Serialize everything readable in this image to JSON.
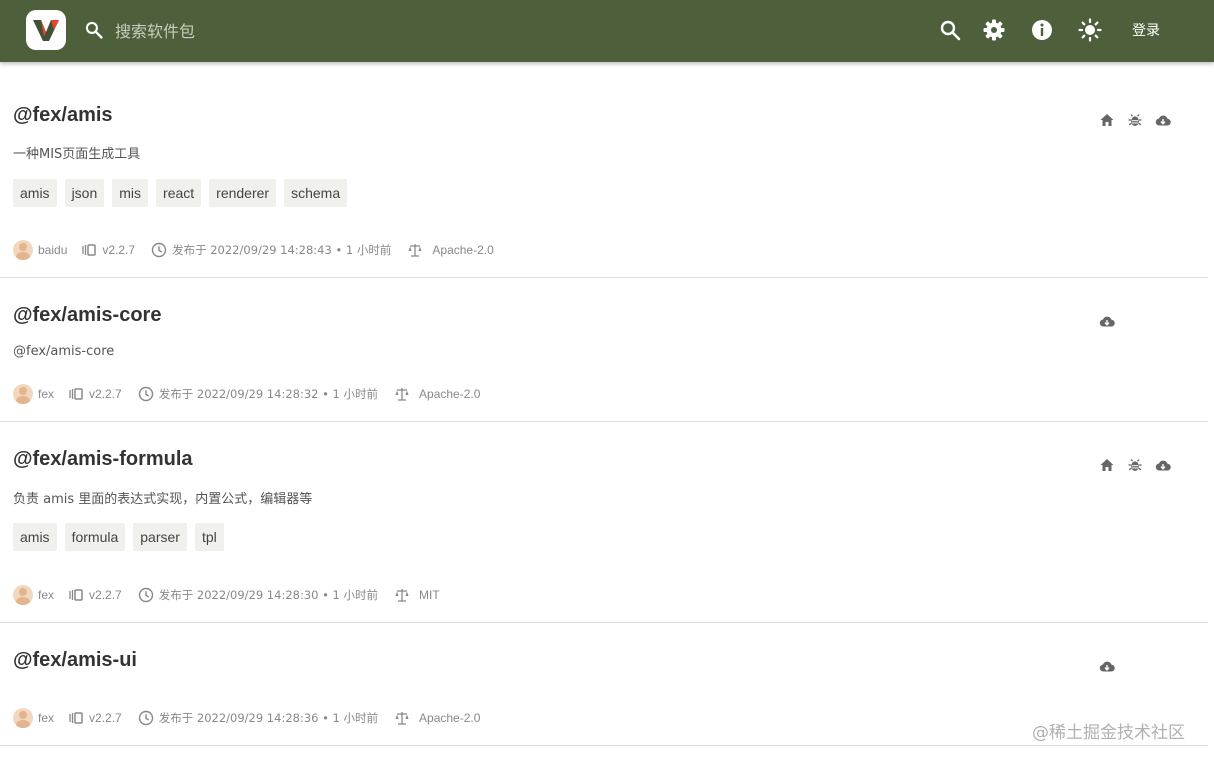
{
  "header": {
    "search_placeholder": "搜索软件包",
    "login_label": "登录",
    "background_color": "#4e5f3b",
    "icons": [
      "search-icon",
      "settings-gear-icon",
      "info-icon",
      "theme-sun-icon"
    ]
  },
  "packages": [
    {
      "name": "@fex/amis",
      "description": "一种MIS页面生成工具",
      "tags": [
        "amis",
        "json",
        "mis",
        "react",
        "renderer",
        "schema"
      ],
      "author": "baidu",
      "version": "v2.2.7",
      "published": "发布于 2022/09/29 14:28:43 • 1 小时前",
      "license": "Apache-2.0",
      "actions": [
        "home-icon",
        "bug-icon",
        "cloud-download-icon"
      ]
    },
    {
      "name": "@fex/amis-core",
      "description": "@fex/amis-core",
      "tags": [],
      "author": "fex",
      "version": "v2.2.7",
      "published": "发布于 2022/09/29 14:28:32 • 1 小时前",
      "license": "Apache-2.0",
      "actions": [
        "cloud-download-icon"
      ]
    },
    {
      "name": "@fex/amis-formula",
      "description": "负责 amis 里面的表达式实现，内置公式，编辑器等",
      "tags": [
        "amis",
        "formula",
        "parser",
        "tpl"
      ],
      "author": "fex",
      "version": "v2.2.7",
      "published": "发布于 2022/09/29 14:28:30 • 1 小时前",
      "license": "MIT",
      "actions": [
        "home-icon",
        "bug-icon",
        "cloud-download-icon"
      ]
    },
    {
      "name": "@fex/amis-ui",
      "description": "",
      "tags": [],
      "author": "fex",
      "version": "v2.2.7",
      "published": "发布于 2022/09/29 14:28:36 • 1 小时前",
      "license": "Apache-2.0",
      "actions": [
        "cloud-download-icon"
      ]
    }
  ],
  "watermark": "@稀土掘金技术社区"
}
